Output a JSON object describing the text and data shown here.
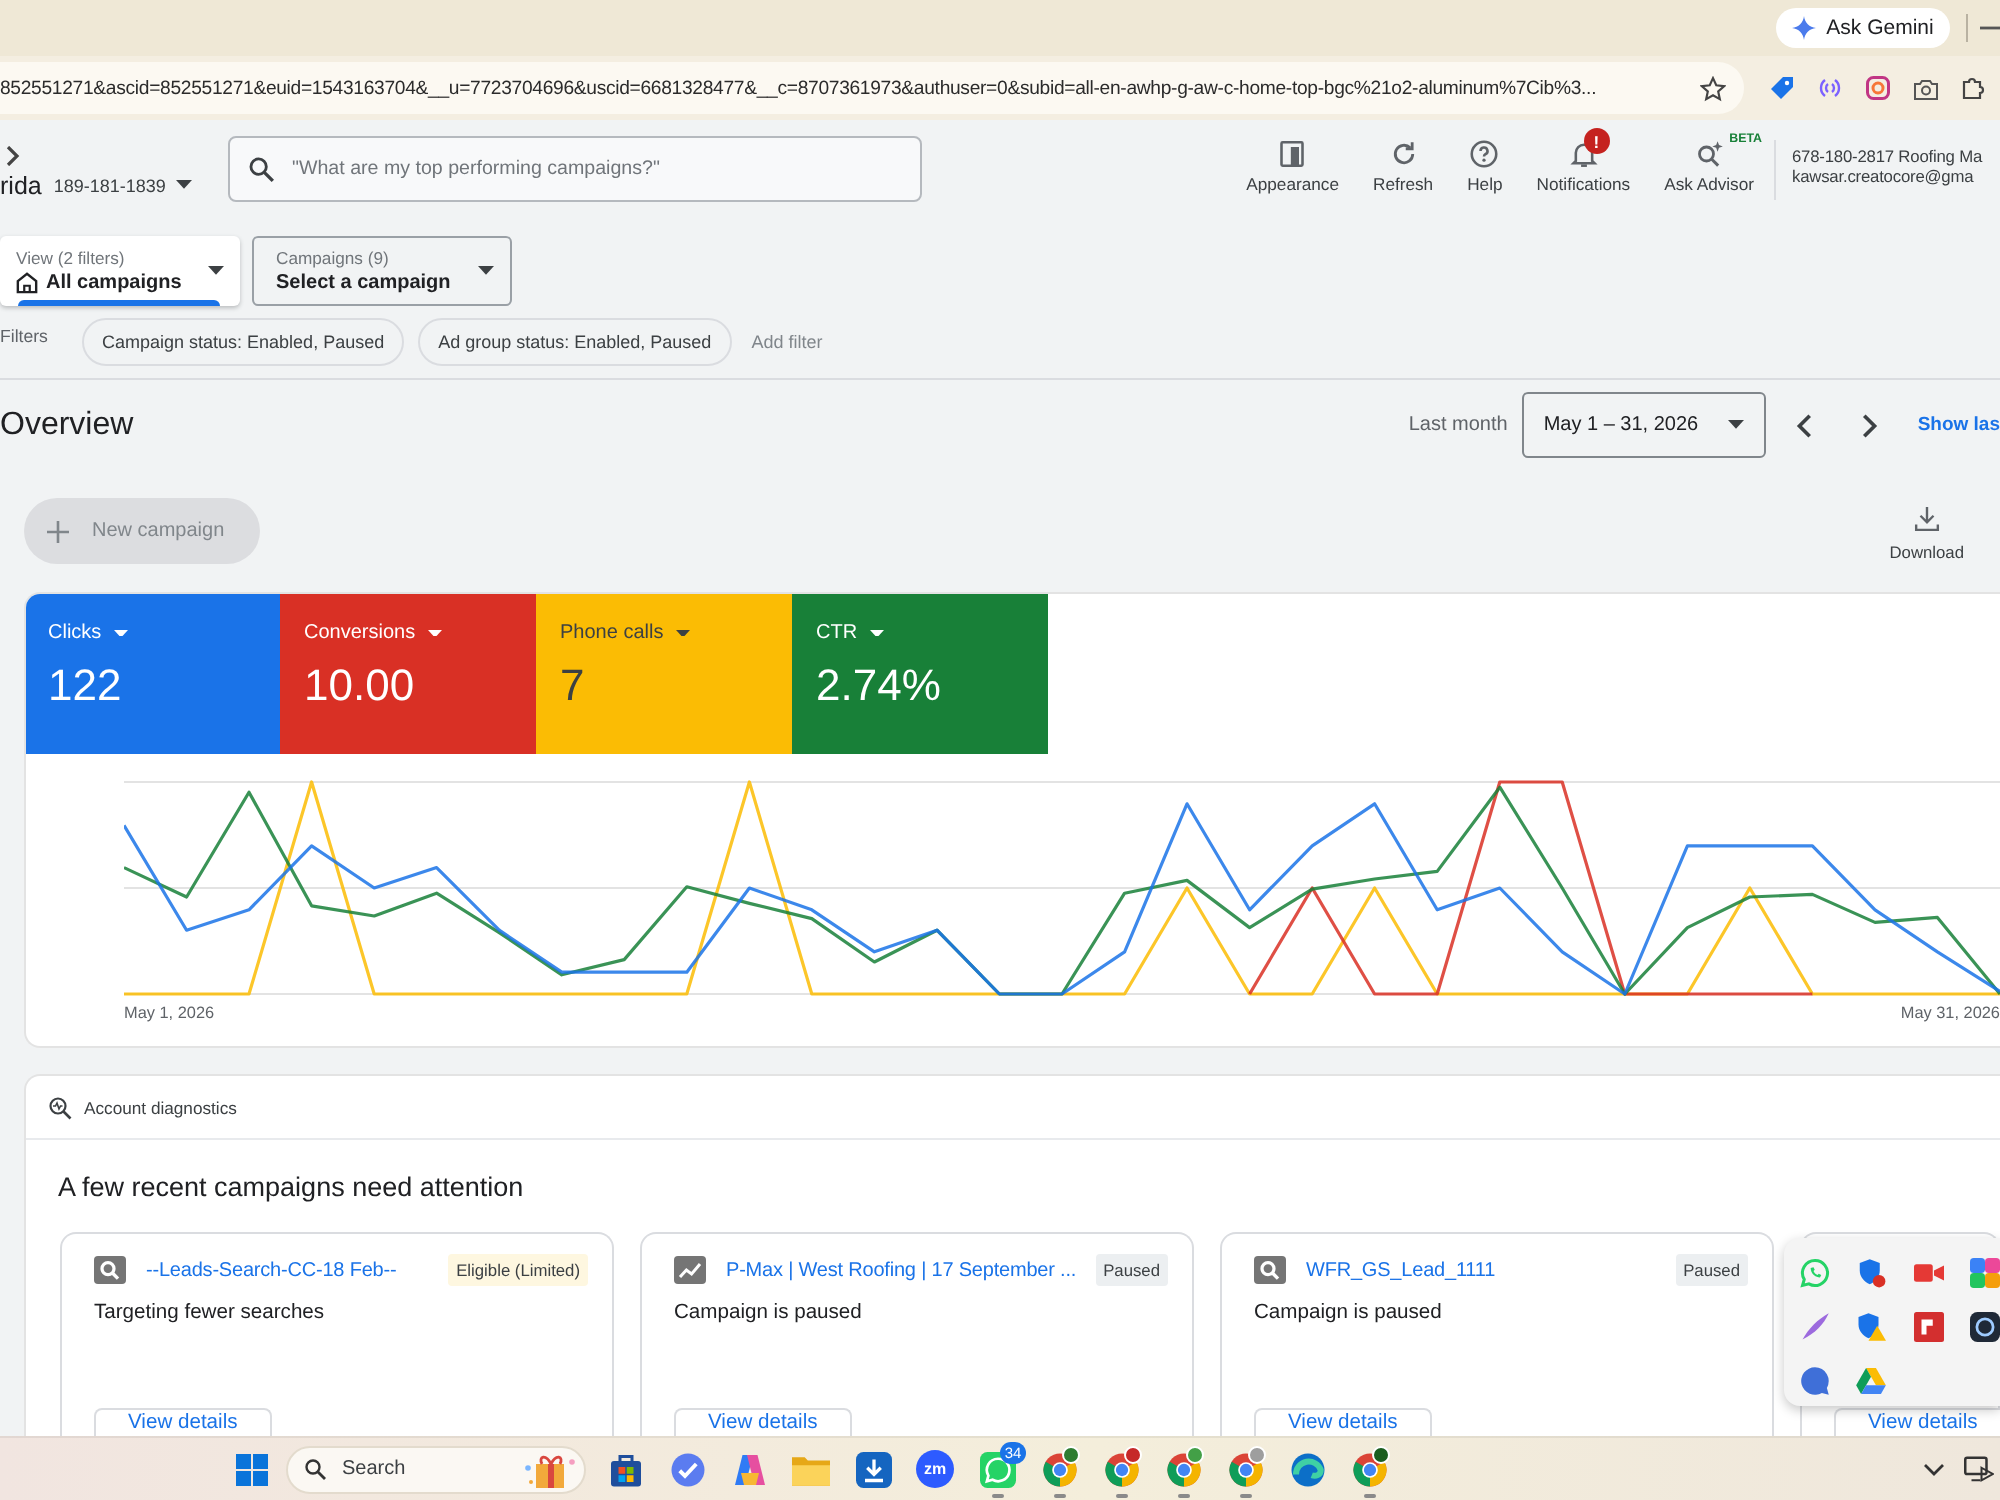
{
  "browser": {
    "gemini_button": "Ask Gemini",
    "url": "852551271&ascid=852551271&euid=1543163704&__u=7723704696&uscid=6681328477&__c=8707361973&authuser=0&subid=all-en-awhp-g-aw-c-home-top-bgc%21o2-aluminum%7Cib%3..."
  },
  "header": {
    "account_name": "rida",
    "account_id": "189-181-1839",
    "search": {
      "placeholder": "\"What are my top performing campaigns?\""
    },
    "tools": [
      {
        "kind": "appearance",
        "label": "Appearance"
      },
      {
        "kind": "refresh",
        "label": "Refresh"
      },
      {
        "kind": "help",
        "label": "Help"
      },
      {
        "kind": "notifications",
        "label": "Notifications",
        "badge": "!"
      },
      {
        "kind": "advisor",
        "label": "Ask Advisor",
        "tag": "BETA"
      }
    ],
    "user": {
      "line_1": "678-180-2817 Roofing Ma",
      "line_2": "kawsar.creatocore@gma"
    }
  },
  "selectors": [
    {
      "kind": "view",
      "caption": "View (2 filters)",
      "value": "All campaigns",
      "selected": true
    },
    {
      "kind": "campaign",
      "caption": "Campaigns (9)",
      "value": "Select a campaign",
      "selected": false
    }
  ],
  "filters": {
    "label": "Filters",
    "chips": [
      "Campaign status: Enabled, Paused",
      "Ad group status: Enabled, Paused"
    ],
    "add_filter": "Add filter"
  },
  "overview": {
    "title": "Overview",
    "date_preset": "Last month",
    "date_range": "May 1 – 31, 2026",
    "show_link": "Show las",
    "new_campaign": {
      "label": "New campaign",
      "disabled": true
    },
    "download": "Download"
  },
  "scorecards": [
    {
      "label": "Clicks",
      "value": "122",
      "color": "#1a73e8"
    },
    {
      "label": "Conversions",
      "value": "10.00",
      "color": "#d93025"
    },
    {
      "label": "Phone calls",
      "value": "7",
      "color": "#fbbc04"
    },
    {
      "label": "CTR",
      "value": "2.74%",
      "color": "#188038"
    }
  ],
  "chart": {
    "start_label": "May 1, 2026",
    "end_label": "May 31, 2026"
  },
  "diagnostics": {
    "title": "Account diagnostics",
    "heading": "A few recent campaigns need attention",
    "cards": [
      {
        "kind": "search",
        "title": "--Leads-Search-CC-18 Feb--",
        "status": {
          "kind": "limited",
          "text": "Eligible (Limited)"
        },
        "message": "Targeting fewer searches",
        "button": "View details"
      },
      {
        "kind": "pmax",
        "title": "P-Max | West Roofing | 17 September ...",
        "status": {
          "kind": "paused",
          "text": "Paused"
        },
        "message": "Campaign is paused",
        "button": "View details"
      },
      {
        "kind": "search",
        "title": "WFR_GS_Lead_1111",
        "status": {
          "kind": "paused",
          "text": "Paused"
        },
        "message": "Campaign is paused",
        "button": "View details"
      },
      {
        "button": "View details"
      }
    ]
  },
  "taskbar": {
    "search": {
      "placeholder": "Search"
    },
    "apps": [
      {
        "kind": "store",
        "running": false
      },
      {
        "kind": "check",
        "running": false
      },
      {
        "kind": "copilot",
        "running": false
      },
      {
        "kind": "folder",
        "running": false
      },
      {
        "kind": "download",
        "running": false
      },
      {
        "kind": "zoom",
        "label": "zm",
        "running": false
      },
      {
        "kind": "whatsapp",
        "badge": "34",
        "running": true
      },
      {
        "kind": "chrome",
        "color": "#2e7d32",
        "running": true
      },
      {
        "kind": "chrome",
        "color": "#c62828",
        "running": true
      },
      {
        "kind": "chrome",
        "color": "#43a047",
        "running": true
      },
      {
        "kind": "chrome",
        "color": "#9e9e9e",
        "running": true
      },
      {
        "kind": "edge",
        "running": false
      },
      {
        "kind": "chrome",
        "color": "#1b5e20",
        "running": true
      }
    ]
  }
}
